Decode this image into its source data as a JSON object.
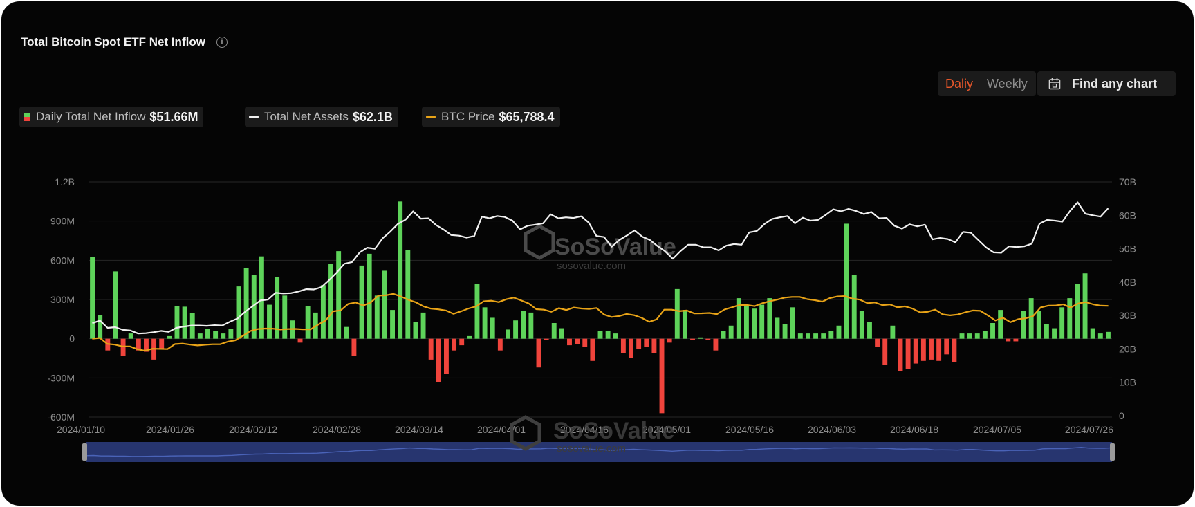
{
  "header": {
    "title": "Total Bitcoin Spot ETF Net Inflow"
  },
  "toolbar": {
    "daily_label": "Daliy",
    "weekly_label": "Weekly",
    "find_label": "Find any chart"
  },
  "legend": [
    {
      "name": "Daily Total Net Inflow",
      "value": "$51.66M"
    },
    {
      "name": "Total Net Assets",
      "value": "$62.1B"
    },
    {
      "name": "BTC Price",
      "value": "$65,788.4"
    }
  ],
  "watermark": {
    "brand": "SoSoValue",
    "url": "sosovalue.com"
  },
  "colors": {
    "positive": "#5ed35a",
    "negative": "#f0443c",
    "assets": "#f0f0f0",
    "price": "#e8a317",
    "navigator": "#27356f"
  },
  "chart_data": {
    "type": "bar",
    "y_left": {
      "ticks": [
        "1.2B",
        "900M",
        "600M",
        "300M",
        "0",
        "-300M",
        "-600M"
      ],
      "range": [
        -600000000,
        1200000000
      ]
    },
    "y_right": {
      "ticks": [
        "70B",
        "60B",
        "50B",
        "40B",
        "30B",
        "20B",
        "10B",
        "0"
      ],
      "range": [
        0,
        70000000000
      ]
    },
    "x_ticks": [
      "2024/01/10",
      "2024/01/26",
      "2024/02/12",
      "2024/02/28",
      "2024/03/14",
      "2024/04/01",
      "2024/04/16",
      "2024/05/01",
      "2024/05/16",
      "2024/06/03",
      "2024/06/18",
      "2024/07/05",
      "2024/07/26"
    ],
    "grid": true,
    "series": [
      {
        "name": "Daily Total Net Inflow",
        "type": "bar",
        "unit": "M USD",
        "values": [
          626,
          180,
          -90,
          515,
          -130,
          40,
          -90,
          -100,
          -160,
          -80,
          20,
          250,
          245,
          195,
          40,
          75,
          60,
          40,
          75,
          400,
          540,
          490,
          630,
          260,
          470,
          330,
          140,
          -30,
          250,
          200,
          410,
          575,
          670,
          90,
          -130,
          560,
          650,
          330,
          520,
          220,
          1050,
          680,
          130,
          200,
          -160,
          -330,
          -270,
          -90,
          -50,
          20,
          420,
          240,
          160,
          -90,
          70,
          140,
          210,
          200,
          -220,
          -10,
          120,
          80,
          -50,
          -40,
          -60,
          -170,
          60,
          60,
          40,
          -110,
          -150,
          -80,
          -60,
          -110,
          -570,
          -30,
          380,
          220,
          -10,
          10,
          -10,
          -90,
          60,
          100,
          310,
          260,
          230,
          260,
          310,
          160,
          110,
          240,
          40,
          40,
          40,
          40,
          60,
          100,
          880,
          490,
          215,
          130,
          -60,
          -200,
          100,
          -250,
          -230,
          -190,
          -170,
          -160,
          -170,
          -120,
          -180,
          40,
          40,
          40,
          60,
          120,
          220,
          -20,
          -20,
          210,
          310,
          210,
          110,
          80,
          240,
          310,
          420,
          500,
          80,
          40,
          52
        ]
      },
      {
        "name": "Total Net Assets",
        "type": "line",
        "axis": "right",
        "unit": "B USD",
        "values": [
          27.7,
          28.5,
          26.3,
          26.5,
          25.7,
          25.5,
          24.6,
          24.7,
          25.0,
          25.4,
          25.1,
          26.3,
          26.7,
          27.0,
          27.0,
          26.9,
          27.1,
          27.0,
          28.1,
          29.1,
          31.1,
          32.8,
          34.5,
          34.8,
          36.8,
          36.6,
          36.7,
          37.2,
          37.9,
          37.8,
          38.5,
          40.6,
          42.9,
          45.5,
          46.0,
          48.9,
          50.3,
          50.0,
          53.1,
          55.1,
          57.4,
          58.7,
          61.2,
          59.0,
          59.1,
          57.1,
          55.7,
          54.1,
          53.9,
          53.3,
          53.8,
          59.6,
          59.1,
          59.8,
          59.5,
          58.4,
          55.8,
          56.9,
          57.2,
          57.6,
          60.3,
          59.1,
          59.4,
          59.2,
          59.7,
          57.8,
          53.8,
          53.5,
          50.6,
          52.6,
          54.0,
          55.5,
          53.6,
          52.6,
          50.8,
          49.2,
          47.0,
          49.3,
          51.2,
          51.2,
          50.4,
          50.4,
          49.5,
          50.9,
          51.4,
          51.2,
          54.9,
          55.3,
          57.4,
          58.9,
          59.4,
          59.8,
          57.6,
          59.3,
          58.4,
          58.6,
          60.1,
          61.8,
          61.2,
          61.9,
          61.3,
          60.4,
          61.0,
          59.1,
          59.2,
          56.9,
          56.0,
          57.3,
          56.7,
          57.2,
          52.8,
          53.2,
          52.9,
          51.9,
          55.0,
          54.8,
          52.6,
          50.4,
          48.9,
          48.8,
          50.7,
          50.5,
          50.7,
          51.5,
          57.5,
          58.6,
          58.4,
          58.1,
          61.3,
          63.9,
          60.5,
          60.0,
          59.6,
          62.1
        ]
      },
      {
        "name": "BTC Price",
        "type": "line",
        "axis": "right",
        "unit": "USD",
        "values": [
          46100,
          46600,
          43000,
          42600,
          41500,
          41500,
          39800,
          38900,
          40100,
          40000,
          39900,
          42900,
          43200,
          42600,
          42100,
          42500,
          42800,
          42800,
          44300,
          45100,
          47800,
          50700,
          51900,
          52200,
          52100,
          51600,
          51900,
          52000,
          51700,
          51700,
          54500,
          57000,
          62500,
          63100,
          66900,
          67800,
          66000,
          67800,
          71900,
          72100,
          73000,
          71400,
          69400,
          67900,
          65500,
          64100,
          63700,
          63000,
          61000,
          62500,
          64200,
          65400,
          68500,
          68900,
          68000,
          69700,
          70700,
          69000,
          67200,
          63800,
          63500,
          62200,
          64400,
          63300,
          64800,
          64200,
          63900,
          64500,
          60600,
          59100,
          59700,
          60900,
          60200,
          58600,
          56200,
          57700,
          63500,
          63500,
          62600,
          63000,
          61200,
          61300,
          61500,
          60800,
          63600,
          64900,
          66300,
          66300,
          65600,
          67300,
          68500,
          69500,
          70700,
          71100,
          71100,
          69800,
          69200,
          68300,
          70400,
          71400,
          71600,
          70100,
          69500,
          67400,
          67800,
          66200,
          66600,
          64900,
          65500,
          64100,
          61900,
          62200,
          63500,
          60700,
          60100,
          60600,
          61900,
          63000,
          62800,
          60100,
          57000,
          58700,
          56000,
          57800,
          58300,
          59600,
          64800,
          65900,
          66000,
          66700,
          64800,
          67200,
          68000,
          66700,
          65900,
          65788
        ]
      }
    ]
  }
}
